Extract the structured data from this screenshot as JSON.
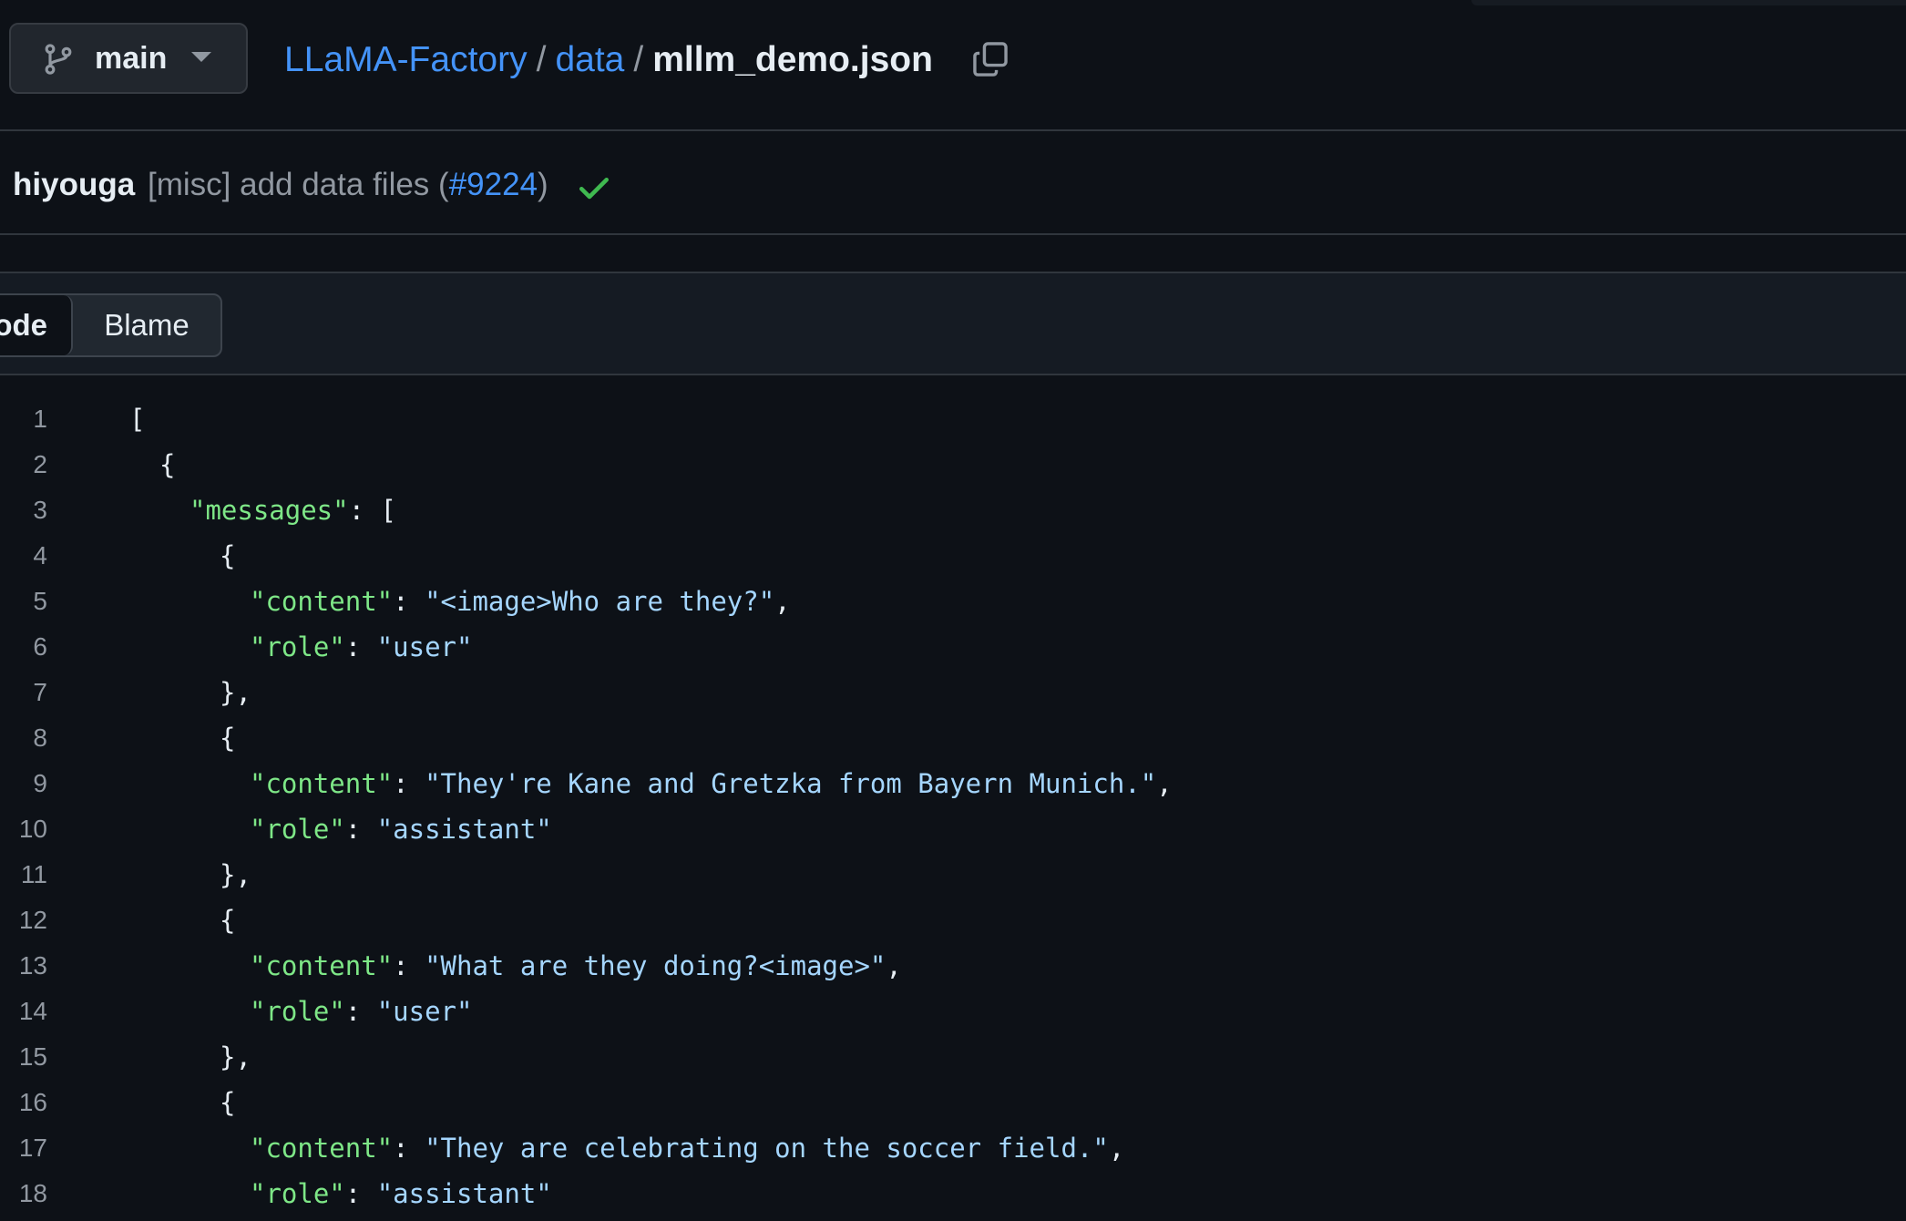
{
  "header": {
    "branch": "main",
    "breadcrumb": {
      "repo": "LLaMA-Factory",
      "folder": "data",
      "separator": "/",
      "file": "mllm_demo.json"
    }
  },
  "commit": {
    "author": "hiyouga",
    "message_prefix": "[misc] add data files (",
    "pr": "#9224",
    "message_suffix": ")",
    "status": "success"
  },
  "toolbar": {
    "tabs": [
      {
        "label": "Code",
        "visible_text": "ode",
        "active": true
      },
      {
        "label": "Blame",
        "active": false
      }
    ]
  },
  "code": {
    "language": "json",
    "lines": [
      {
        "n": "1",
        "indent": 0,
        "tokens": [
          {
            "t": "pun",
            "v": "["
          }
        ]
      },
      {
        "n": "2",
        "indent": 1,
        "tokens": [
          {
            "t": "pun",
            "v": "{"
          }
        ]
      },
      {
        "n": "3",
        "indent": 2,
        "tokens": [
          {
            "t": "key",
            "v": "\"messages\""
          },
          {
            "t": "pun",
            "v": ": ["
          }
        ]
      },
      {
        "n": "4",
        "indent": 3,
        "tokens": [
          {
            "t": "pun",
            "v": "{"
          }
        ]
      },
      {
        "n": "5",
        "indent": 4,
        "tokens": [
          {
            "t": "key",
            "v": "\"content\""
          },
          {
            "t": "pun",
            "v": ": "
          },
          {
            "t": "str",
            "v": "\"<image>Who are they?\""
          },
          {
            "t": "pun",
            "v": ","
          }
        ]
      },
      {
        "n": "6",
        "indent": 4,
        "tokens": [
          {
            "t": "key",
            "v": "\"role\""
          },
          {
            "t": "pun",
            "v": ": "
          },
          {
            "t": "str",
            "v": "\"user\""
          }
        ]
      },
      {
        "n": "7",
        "indent": 3,
        "tokens": [
          {
            "t": "pun",
            "v": "},"
          }
        ]
      },
      {
        "n": "8",
        "indent": 3,
        "tokens": [
          {
            "t": "pun",
            "v": "{"
          }
        ]
      },
      {
        "n": "9",
        "indent": 4,
        "tokens": [
          {
            "t": "key",
            "v": "\"content\""
          },
          {
            "t": "pun",
            "v": ": "
          },
          {
            "t": "str",
            "v": "\"They're Kane and Gretzka from Bayern Munich.\""
          },
          {
            "t": "pun",
            "v": ","
          }
        ]
      },
      {
        "n": "10",
        "indent": 4,
        "tokens": [
          {
            "t": "key",
            "v": "\"role\""
          },
          {
            "t": "pun",
            "v": ": "
          },
          {
            "t": "str",
            "v": "\"assistant\""
          }
        ]
      },
      {
        "n": "11",
        "indent": 3,
        "tokens": [
          {
            "t": "pun",
            "v": "},"
          }
        ]
      },
      {
        "n": "12",
        "indent": 3,
        "tokens": [
          {
            "t": "pun",
            "v": "{"
          }
        ]
      },
      {
        "n": "13",
        "indent": 4,
        "tokens": [
          {
            "t": "key",
            "v": "\"content\""
          },
          {
            "t": "pun",
            "v": ": "
          },
          {
            "t": "str",
            "v": "\"What are they doing?<image>\""
          },
          {
            "t": "pun",
            "v": ","
          }
        ]
      },
      {
        "n": "14",
        "indent": 4,
        "tokens": [
          {
            "t": "key",
            "v": "\"role\""
          },
          {
            "t": "pun",
            "v": ": "
          },
          {
            "t": "str",
            "v": "\"user\""
          }
        ]
      },
      {
        "n": "15",
        "indent": 3,
        "tokens": [
          {
            "t": "pun",
            "v": "},"
          }
        ]
      },
      {
        "n": "16",
        "indent": 3,
        "tokens": [
          {
            "t": "pun",
            "v": "{"
          }
        ]
      },
      {
        "n": "17",
        "indent": 4,
        "tokens": [
          {
            "t": "key",
            "v": "\"content\""
          },
          {
            "t": "pun",
            "v": ": "
          },
          {
            "t": "str",
            "v": "\"They are celebrating on the soccer field.\""
          },
          {
            "t": "pun",
            "v": ","
          }
        ]
      },
      {
        "n": "18",
        "indent": 4,
        "tokens": [
          {
            "t": "key",
            "v": "\"role\""
          },
          {
            "t": "pun",
            "v": ": "
          },
          {
            "t": "str",
            "v": "\"assistant\""
          }
        ]
      }
    ]
  },
  "colors": {
    "background": "#0d1117",
    "link": "#4493f8",
    "json_key": "#7ee787",
    "json_string": "#a5d6ff",
    "muted": "#9198a1",
    "success": "#3fb950"
  },
  "icons": {
    "branch": "git-branch-icon",
    "caret": "triangle-down-icon",
    "copy": "copy-icon",
    "status": "check-icon"
  }
}
